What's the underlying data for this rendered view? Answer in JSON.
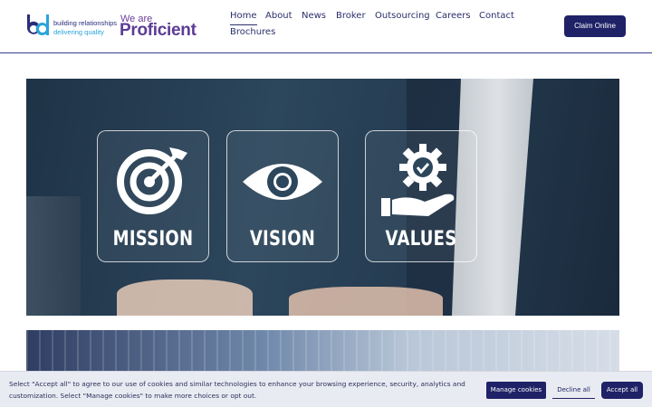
{
  "brand": {
    "tagline_1": "building relationships",
    "tagline_2": "delivering quality",
    "we_are": "We are",
    "proficient": "Proficient",
    "mark_colors": {
      "b": "#2a2f7a",
      "d": "#2aa3d8"
    }
  },
  "nav": {
    "items": [
      {
        "label": "Home",
        "active": true
      },
      {
        "label": "About",
        "active": false
      },
      {
        "label": "News",
        "active": false
      },
      {
        "label": "Broker",
        "active": false
      },
      {
        "label": "Outsourcing",
        "active": false
      },
      {
        "label": "Careers",
        "active": false
      },
      {
        "label": "Contact",
        "active": false
      },
      {
        "label": "Brochures",
        "active": false
      }
    ]
  },
  "cta": {
    "label": "Claim Online"
  },
  "hero": {
    "cards": [
      {
        "label": "MISSION",
        "icon": "target-icon"
      },
      {
        "label": "VISION",
        "icon": "eye-icon"
      },
      {
        "label": "VALUES",
        "icon": "gear-hand-icon"
      }
    ]
  },
  "cookie": {
    "text": "Select \"Accept all\" to agree to our use of cookies and similar technologies to enhance your browsing experience, security, analytics and customization. Select \"Manage cookies\" to make more choices or opt out.",
    "manage_label": "Manage cookies",
    "decline_label": "Decline all",
    "accept_label": "Accept all"
  },
  "colors": {
    "brand_navy": "#1f2266",
    "brand_purple": "#5c3c96",
    "brand_cyan": "#2aa3d8"
  }
}
